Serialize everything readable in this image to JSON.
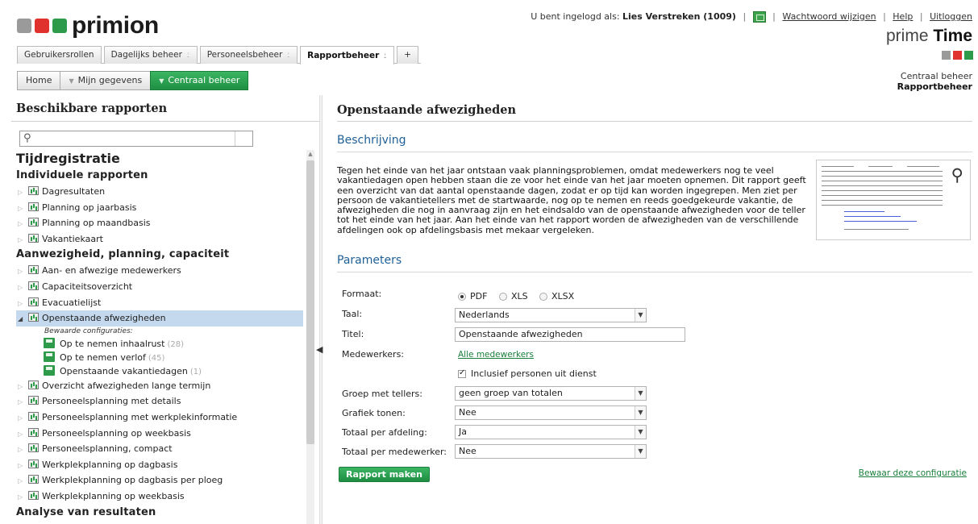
{
  "header": {
    "brand": "primion",
    "logo_colors": [
      "#9a9a9a",
      "#e0312f",
      "#2e9b4a"
    ],
    "logged_in_label": "U bent ingelogd als:",
    "user": "Lies Verstreken (1009)",
    "links": [
      "Wachtwoord wijzigen",
      "Help",
      "Uitloggen"
    ],
    "product_light": "prime",
    "product_bold": "Time",
    "product_colors": [
      "#9a9a9a",
      "#e0312f",
      "#2e9b4a"
    ]
  },
  "app_tabs": [
    {
      "label": "Gebruikersrollen",
      "pin": ""
    },
    {
      "label": "Dagelijks beheer",
      "pin": "⍘"
    },
    {
      "label": "Personeelsbeheer",
      "pin": "⍘"
    },
    {
      "label": "Rapportbeheer",
      "pin": "⍘"
    },
    {
      "label": "+",
      "pin": ""
    }
  ],
  "nav": {
    "home": "Home",
    "mijn": "Mijn gegevens",
    "centraal": "Centraal beheer",
    "crumb_1": "Centraal beheer",
    "crumb_2": "Rapportbeheer"
  },
  "sidebar": {
    "title": "Beschikbare rapporten",
    "search_placeholder": "",
    "category": "Tijdregistratie",
    "group1": "Individuele rapporten",
    "group1_items": [
      "Dagresultaten",
      "Planning op jaarbasis",
      "Planning op maandbasis",
      "Vakantiekaart"
    ],
    "group2": "Aanwezigheid, planning, capaciteit",
    "group2_items_before": [
      "Aan- en afwezige medewerkers",
      "Capaciteitsoverzicht",
      "Evacuatielijst"
    ],
    "selected_item": "Openstaande afwezigheden",
    "saved_header": "Bewaarde configuraties:",
    "saved": [
      {
        "label": "Op te nemen inhaalrust",
        "count": "(28)"
      },
      {
        "label": "Op te nemen verlof",
        "count": "(45)"
      },
      {
        "label": "Openstaande vakantiedagen",
        "count": "(1)"
      }
    ],
    "group2_items_after": [
      "Overzicht afwezigheden lange termijn",
      "Personeelsplanning met details",
      "Personeelsplanning met werkplekinformatie",
      "Personeelsplanning op weekbasis",
      "Personeelsplanning, compact",
      "Werkplekplanning op dagbasis",
      "Werkplekplanning op dagbasis per ploeg",
      "Werkplekplanning op weekbasis"
    ],
    "group3": "Analyse van resultaten"
  },
  "main": {
    "title": "Openstaande afwezigheden",
    "desc_title": "Beschrijving",
    "desc_lines": [
      "Tegen het einde van het jaar ontstaan vaak planningsproblemen, omdat medewerkers nog te veel",
      "vakantiedagen open hebben staan die ze voor het einde van het jaar moeten opnemen. Dit rapport geeft",
      "een overzicht van dat aantal openstaande dagen, zodat er op tijd kan worden ingegrepen. Men ziet per",
      "persoon de vakantietellers met de startwaarde, nog op te nemen en reeds goedgekeurde vakantie, de",
      "afwezigheden die nog in aanvraag zijn en het eindsaldo van de openstaande afwezigheden voor de teller",
      "tot het einde van het jaar. Aan het einde van het rapport worden de afwezigheden van de verschillende",
      "afdelingen ook op afdelingsbasis met mekaar vergeleken."
    ],
    "params_title": "Parameters",
    "formaat_label": "Formaat:",
    "formats": [
      "PDF",
      "XLS",
      "XLSX"
    ],
    "taal_label": "Taal:",
    "taal_value": "Nederlands",
    "titel_label": "Titel:",
    "titel_value": "Openstaande afwezigheden",
    "medewerkers_label": "Medewerkers:",
    "medewerkers_link": "Alle medewerkers",
    "inclusief_label": "Inclusief personen uit dienst",
    "groep_label": "Groep met tellers:",
    "groep_value": "geen groep van totalen",
    "grafiek_label": "Grafiek tonen:",
    "grafiek_value": "Nee",
    "afdeling_label": "Totaal per afdeling:",
    "afdeling_value": "Ja",
    "medewerker_label": "Totaal per medewerker:",
    "medewerker_value": "Nee",
    "btn_make": "Rapport maken",
    "save_link": "Bewaar deze configuratie"
  }
}
